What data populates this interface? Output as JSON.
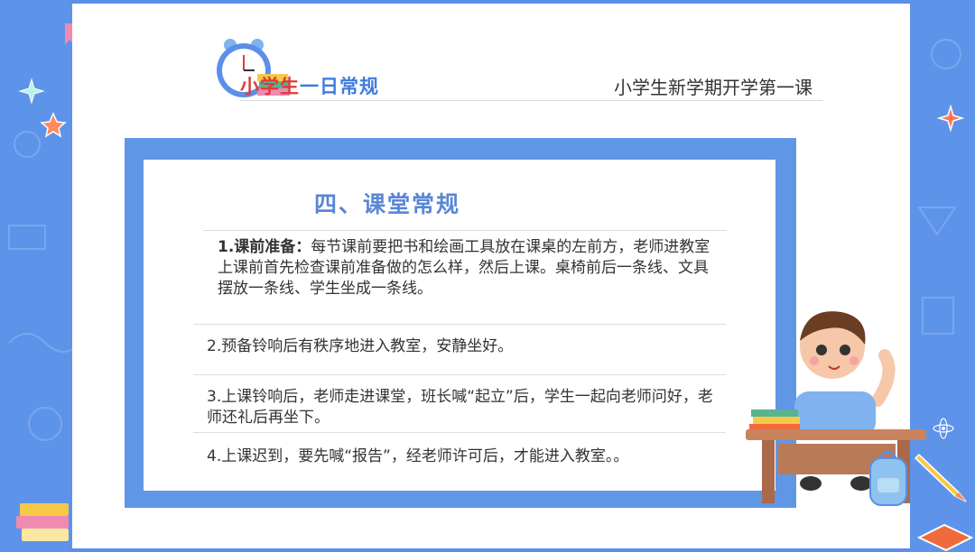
{
  "header": {
    "title_part1": "小学生",
    "title_part2": "一日常规",
    "subtitle": "小学生新学期开学第一课"
  },
  "section": {
    "title": "四、课堂常规",
    "items": [
      {
        "lead": "1.课前准备：",
        "text": "每节课前要把书和绘画工具放在课桌的左前方，老师进教室上课前首先检查课前准备做的怎么样，然后上课。桌椅前后一条线、文具摆放一条线、学生坐成一条线。"
      },
      {
        "text": "2.预备铃响后有秩序地进入教室，安静坐好。"
      },
      {
        "text": "3.上课铃响后，老师走进课堂，班长喊“起立”后，学生一起向老师问好，老师还礼后再坐下。"
      },
      {
        "text": "4.上课迟到，要先喊“报告”，经老师许可后，才能进入教室。。"
      }
    ]
  },
  "colors": {
    "background": "#5b8fe8",
    "frame": "#6096e6",
    "title_red": "#e03a3a",
    "title_blue": "#3f7be0",
    "section_title": "#5a86d6"
  },
  "icons": [
    "alarm-clock-icon",
    "books-icon",
    "star-icon",
    "sparkle-icon",
    "boy-at-desk-illustration",
    "backpack-icon",
    "pencil-icon"
  ]
}
